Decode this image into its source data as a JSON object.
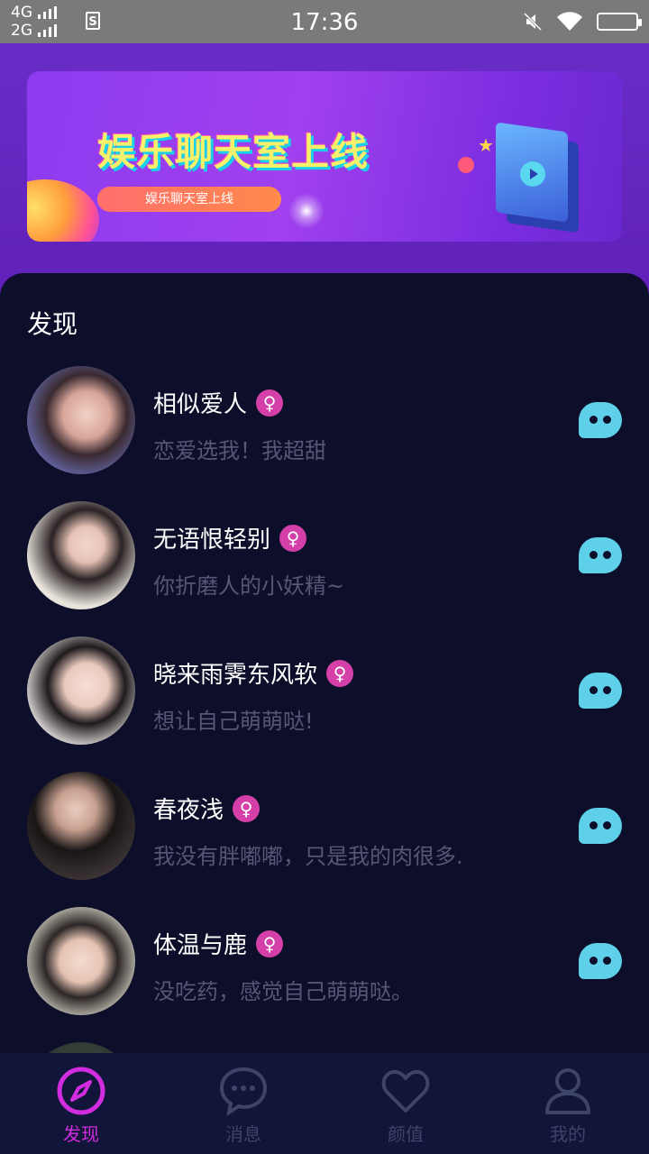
{
  "status_bar": {
    "network_top": "4G",
    "network_bottom": "2G",
    "sim_icon": "S",
    "time": "17:36"
  },
  "banner": {
    "title": "娱乐聊天室上线",
    "pill": "娱乐聊天室上线"
  },
  "section": {
    "title": "发现"
  },
  "users": [
    {
      "name": "相似爱人",
      "signature": "恋爱选我！我超甜",
      "gender_symbol": "♀"
    },
    {
      "name": "无语恨轻别",
      "signature": "你折磨人的小妖精~",
      "gender_symbol": "♀"
    },
    {
      "name": "晓来雨霁东风软",
      "signature": "想让自己萌萌哒!",
      "gender_symbol": "♀"
    },
    {
      "name": "春夜浅",
      "signature": "我没有胖嘟嘟，只是我的肉很多.",
      "gender_symbol": "♀"
    },
    {
      "name": "体温与鹿",
      "signature": "没吃药，感觉自己萌萌哒。",
      "gender_symbol": "♀"
    }
  ],
  "tabs": [
    {
      "label": "发现",
      "icon": "compass-icon",
      "active": true
    },
    {
      "label": "消息",
      "icon": "chat-bubble-icon",
      "active": false
    },
    {
      "label": "颜值",
      "icon": "heart-icon",
      "active": false
    },
    {
      "label": "我的",
      "icon": "person-icon",
      "active": false
    }
  ],
  "colors": {
    "accent": "#d22ce0",
    "chat_button": "#5fd0ea",
    "gender_badge": "#d43fa8",
    "background": "#0d0e2a"
  }
}
